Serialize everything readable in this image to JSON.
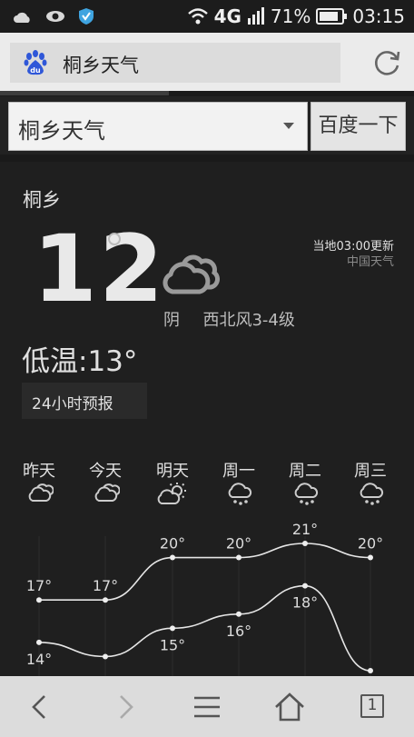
{
  "status_bar": {
    "network": "4G",
    "battery_percent": "71%",
    "time": "03:15",
    "left_icons": [
      "cloud-icon",
      "eye-icon",
      "shield-icon"
    ]
  },
  "browser": {
    "address_text": "桐乡天气",
    "logo_icon": "baidu-paw-icon",
    "refresh_icon": "refresh-icon"
  },
  "search": {
    "query": "桐乡天气",
    "button_label": "百度一下"
  },
  "weather": {
    "city": "桐乡",
    "current_temp": "12",
    "low_temp": "低温:13°",
    "forecast_button": "24小时预报",
    "condition": "阴",
    "wind": "西北风3-4级",
    "update_text": "当地03:00更新",
    "source": "中国天气",
    "current_icon": "cloud-icon"
  },
  "days": [
    {
      "label": "昨天",
      "icon": "cloud-icon"
    },
    {
      "label": "今天",
      "icon": "cloud-icon"
    },
    {
      "label": "明天",
      "icon": "partly-sunny-icon"
    },
    {
      "label": "周一",
      "icon": "rain-icon"
    },
    {
      "label": "周二",
      "icon": "rain-icon"
    },
    {
      "label": "周三",
      "icon": "rain-icon"
    }
  ],
  "chart_data": {
    "type": "line",
    "categories": [
      "昨天",
      "今天",
      "明天",
      "周一",
      "周二",
      "周三"
    ],
    "series": [
      {
        "values": [
          17,
          17,
          20,
          20,
          21,
          20
        ]
      },
      {
        "values": [
          14,
          13,
          15,
          16,
          18,
          12
        ]
      }
    ],
    "value_labels": [
      [
        "17°",
        "17°",
        "20°",
        "20°",
        "21°",
        "20°"
      ],
      [
        "14°",
        "",
        "15°",
        "16°",
        "18°",
        ""
      ]
    ]
  },
  "nav_icons": [
    "back-icon",
    "forward-icon",
    "menu-icon",
    "home-icon",
    "tabs-icon"
  ],
  "tab_count": "1"
}
